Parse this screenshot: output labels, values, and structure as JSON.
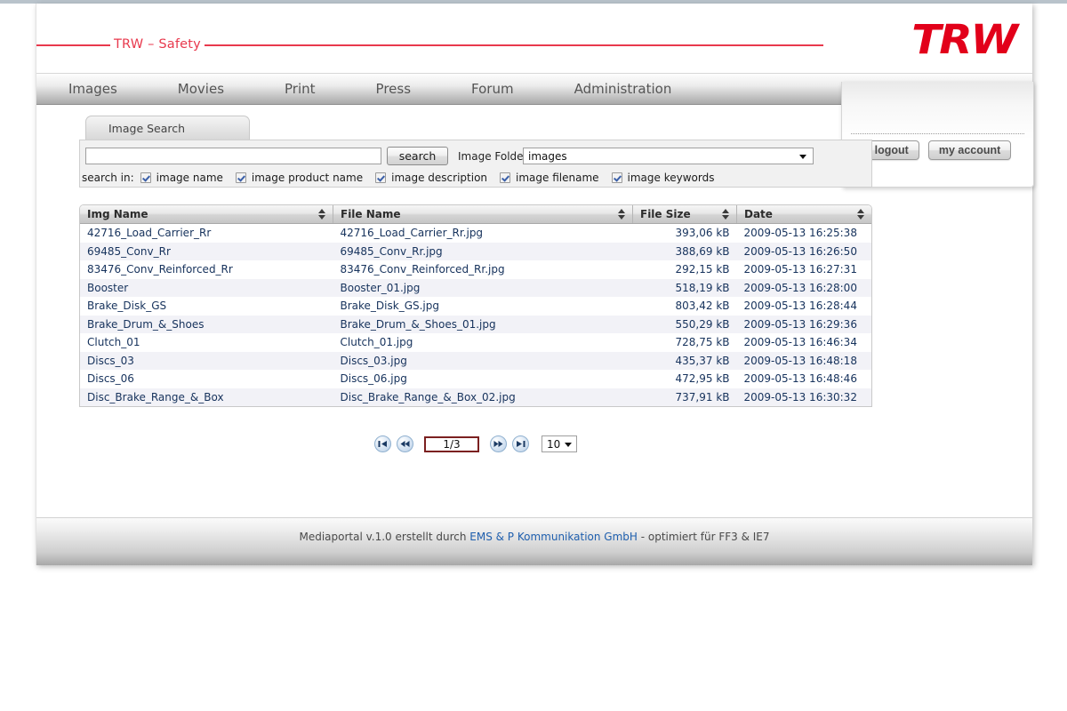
{
  "brand": {
    "tagline": "TRW – Safety",
    "logo_text": "TRW",
    "accent_red": "#e2001a",
    "line_red": "#e8394d"
  },
  "nav": {
    "items": [
      {
        "label": "Images"
      },
      {
        "label": "Movies"
      },
      {
        "label": "Print"
      },
      {
        "label": "Press"
      },
      {
        "label": "Forum"
      },
      {
        "label": "Administration"
      }
    ]
  },
  "account": {
    "logout_label": "logout",
    "my_account_label": "my account"
  },
  "tab": {
    "label": "Image Search"
  },
  "search": {
    "query_value": "",
    "placeholder": "",
    "button_label": "search",
    "folder_label": "Image Folder",
    "folder_value": "images",
    "search_in_label": "search in:",
    "options": [
      {
        "label": "image name",
        "checked": true
      },
      {
        "label": "image product name",
        "checked": true
      },
      {
        "label": "image description",
        "checked": true
      },
      {
        "label": "image filename",
        "checked": true
      },
      {
        "label": "image keywords",
        "checked": true
      }
    ]
  },
  "table": {
    "columns": [
      {
        "label": "Img Name"
      },
      {
        "label": "File Name"
      },
      {
        "label": "File Size"
      },
      {
        "label": "Date"
      }
    ],
    "rows": [
      {
        "img_name": "42716_Load_Carrier_Rr",
        "file_name": "42716_Load_Carrier_Rr.jpg",
        "file_size": "393,06 kB",
        "date": "2009-05-13 16:25:38"
      },
      {
        "img_name": "69485_Conv_Rr",
        "file_name": "69485_Conv_Rr.jpg",
        "file_size": "388,69 kB",
        "date": "2009-05-13 16:26:50"
      },
      {
        "img_name": "83476_Conv_Reinforced_Rr",
        "file_name": "83476_Conv_Reinforced_Rr.jpg",
        "file_size": "292,15 kB",
        "date": "2009-05-13 16:27:31"
      },
      {
        "img_name": "Booster",
        "file_name": "Booster_01.jpg",
        "file_size": "518,19 kB",
        "date": "2009-05-13 16:28:00"
      },
      {
        "img_name": "Brake_Disk_GS",
        "file_name": "Brake_Disk_GS.jpg",
        "file_size": "803,42 kB",
        "date": "2009-05-13 16:28:44"
      },
      {
        "img_name": "Brake_Drum_&_Shoes",
        "file_name": "Brake_Drum_&_Shoes_01.jpg",
        "file_size": "550,29 kB",
        "date": "2009-05-13 16:29:36"
      },
      {
        "img_name": "Clutch_01",
        "file_name": "Clutch_01.jpg",
        "file_size": "728,75 kB",
        "date": "2009-05-13 16:46:34"
      },
      {
        "img_name": "Discs_03",
        "file_name": "Discs_03.jpg",
        "file_size": "435,37 kB",
        "date": "2009-05-13 16:48:18"
      },
      {
        "img_name": "Discs_06",
        "file_name": "Discs_06.jpg",
        "file_size": "472,95 kB",
        "date": "2009-05-13 16:48:46"
      },
      {
        "img_name": "Disc_Brake_Range_&_Box",
        "file_name": "Disc_Brake_Range_&_Box_02.jpg",
        "file_size": "737,91 kB",
        "date": "2009-05-13 16:30:32"
      }
    ]
  },
  "pager": {
    "first_icon": "first-page-icon",
    "prev_icon": "previous-page-icon",
    "next_icon": "next-page-icon",
    "last_icon": "last-page-icon",
    "page_value": "1/3",
    "per_page_value": "10"
  },
  "footer": {
    "text_before": "Mediaportal v.1.0 erstellt durch ",
    "link_text": "EMS & P Kommunikation GmbH",
    "text_after": " - optimiert für FF3 & IE7"
  }
}
